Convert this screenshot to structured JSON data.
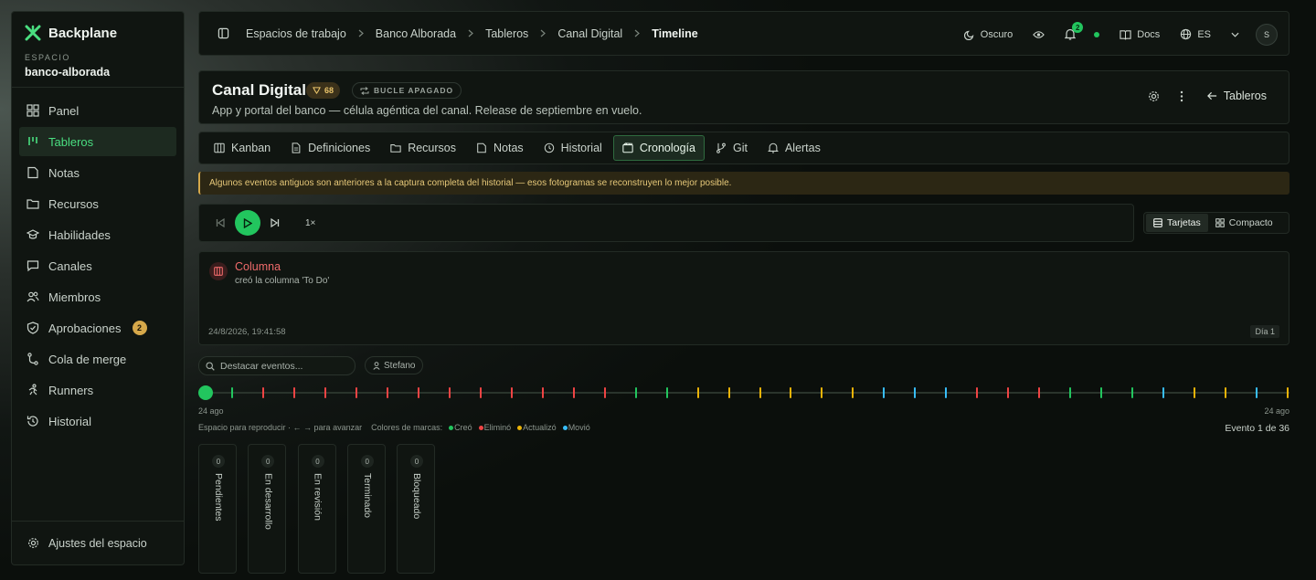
{
  "sidebar": {
    "brand": "Backplane",
    "workspace_label": "ESPACIO",
    "workspace_name": "banco-alborada",
    "items": [
      {
        "label": "Panel",
        "icon": "grid-icon"
      },
      {
        "label": "Tableros",
        "icon": "board-icon"
      },
      {
        "label": "Notas",
        "icon": "note-icon"
      },
      {
        "label": "Recursos",
        "icon": "folder-icon"
      },
      {
        "label": "Habilidades",
        "icon": "graduation-cap-icon"
      },
      {
        "label": "Canales",
        "icon": "chat-icon"
      },
      {
        "label": "Miembros",
        "icon": "users-icon"
      },
      {
        "label": "Aprobaciones",
        "icon": "shield-check-icon",
        "badge": "2"
      },
      {
        "label": "Cola de merge",
        "icon": "git-merge-icon"
      },
      {
        "label": "Runners",
        "icon": "runner-icon"
      },
      {
        "label": "Historial",
        "icon": "history-icon"
      }
    ],
    "active_item": "Tableros",
    "settings_label": "Ajustes del espacio"
  },
  "header": {
    "breadcrumbs": [
      "Espacios de trabajo",
      "Banco Alborada",
      "Tableros",
      "Canal Digital",
      "Timeline"
    ],
    "theme_label": "Oscuro",
    "notifications_count": "2",
    "docs_label": "Docs",
    "language": "ES",
    "avatar_initial": "S"
  },
  "project": {
    "title": "Canal Digital",
    "score": "68",
    "loop_status": "BUCLE APAGADO",
    "description": "App y portal del banco — célula agéntica del canal. Release de septiembre en vuelo.",
    "back_label": "Tableros"
  },
  "tabs": [
    {
      "label": "Kanban",
      "icon": "kanban-icon"
    },
    {
      "label": "Definiciones",
      "icon": "document-icon"
    },
    {
      "label": "Recursos",
      "icon": "folder-icon"
    },
    {
      "label": "Notas",
      "icon": "note-icon"
    },
    {
      "label": "Historial",
      "icon": "clock-icon"
    },
    {
      "label": "Cronología",
      "icon": "film-icon"
    },
    {
      "label": "Git",
      "icon": "git-branch-icon"
    },
    {
      "label": "Alertas",
      "icon": "bell-icon"
    }
  ],
  "active_tab": "Cronología",
  "warning": "Algunos eventos antiguos son anteriores a la captura completa del historial — esos fotogramas se reconstruyen lo mejor posible.",
  "player": {
    "speed": "1×",
    "view_cards": "Tarjetas",
    "view_compact": "Compacto",
    "active_view": "Tarjetas"
  },
  "event": {
    "title": "Columna",
    "description": "creó la columna 'To Do'",
    "timestamp": "24/8/2026, 19:41:58",
    "day": "Día 1",
    "color": "#ef4444"
  },
  "filters": {
    "search_placeholder": "Destacar eventos...",
    "user_chip": "Stefano"
  },
  "timeline": {
    "start_date": "24 ago",
    "end_date": "24 ago",
    "hint": "Espacio para reproducir · ← → para avanzar",
    "legend_title": "Colores de marcas:",
    "legend": [
      {
        "label": "Creó",
        "color": "#22c55e"
      },
      {
        "label": "Eliminó",
        "color": "#ef4444"
      },
      {
        "label": "Actualizó",
        "color": "#eab308"
      },
      {
        "label": "Movió",
        "color": "#38bdf8"
      }
    ],
    "counter": "Evento 1 de 36",
    "current_event": 1,
    "total_events": 36,
    "marks": [
      "creó",
      "eliminó",
      "eliminó",
      "eliminó",
      "eliminó",
      "eliminó",
      "eliminó",
      "eliminó",
      "eliminó",
      "eliminó",
      "eliminó",
      "eliminó",
      "eliminó",
      "creó",
      "creó",
      "actualizó",
      "actualizó",
      "actualizó",
      "actualizó",
      "actualizó",
      "actualizó",
      "movió",
      "movió",
      "movió",
      "eliminó",
      "eliminó",
      "eliminó",
      "creó",
      "creó",
      "creó",
      "movió",
      "actualizó",
      "actualizó",
      "movió",
      "actualizó"
    ]
  },
  "columns": [
    {
      "name": "Pendientes",
      "count": "0"
    },
    {
      "name": "En desarrollo",
      "count": "0"
    },
    {
      "name": "En revisión",
      "count": "0"
    },
    {
      "name": "Terminado",
      "count": "0"
    },
    {
      "name": "Bloqueado",
      "count": "0"
    }
  ]
}
